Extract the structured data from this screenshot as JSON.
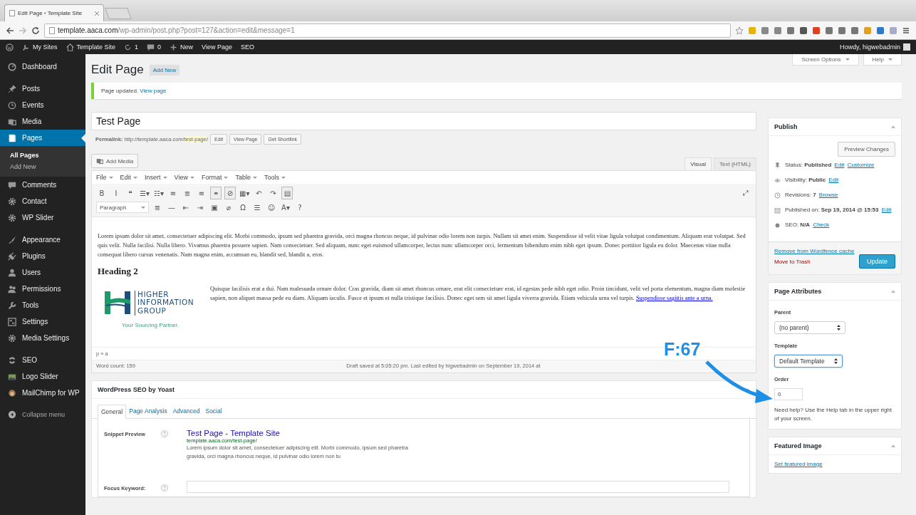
{
  "browser": {
    "tab_title": "Edit Page ‹ Template Site",
    "url_host": "template.aaca.com",
    "url_path": "/wp-admin/post.php?post=127&action=edit&message=1"
  },
  "admin_bar": {
    "items": [
      {
        "kind": "sites",
        "label": "My Sites"
      },
      {
        "kind": "home",
        "label": "Template Site"
      },
      {
        "kind": "updates",
        "label": "1"
      },
      {
        "kind": "comments",
        "label": "0"
      },
      {
        "kind": "new",
        "label": "New"
      },
      {
        "kind": "plain",
        "label": "View Page"
      },
      {
        "kind": "plain",
        "label": "SEO"
      }
    ],
    "greeting": "Howdy, higwebadmin"
  },
  "sidebar": {
    "groups": [
      {
        "items": [
          {
            "kind": "dashboard",
            "label": "Dashboard",
            "selected": false
          }
        ]
      },
      {
        "items": [
          {
            "kind": "pin",
            "label": "Posts",
            "selected": false
          },
          {
            "kind": "clock",
            "label": "Events",
            "selected": false
          },
          {
            "kind": "media",
            "label": "Media",
            "selected": false
          },
          {
            "kind": "page",
            "label": "Pages",
            "selected": true,
            "children": [
              {
                "label": "All Pages",
                "selected": true
              },
              {
                "label": "Add New",
                "selected": false
              }
            ]
          },
          {
            "kind": "comment",
            "label": "Comments",
            "selected": false
          },
          {
            "kind": "gear",
            "label": "Contact",
            "selected": false
          },
          {
            "kind": "gear",
            "label": "WP Slider",
            "selected": false
          }
        ]
      },
      {
        "items": [
          {
            "kind": "brush",
            "label": "Appearance",
            "selected": false
          },
          {
            "kind": "plug",
            "label": "Plugins",
            "selected": false
          },
          {
            "kind": "user",
            "label": "Users",
            "selected": false
          },
          {
            "kind": "users",
            "label": "Permissions",
            "selected": false
          },
          {
            "kind": "wrench",
            "label": "Tools",
            "selected": false
          },
          {
            "kind": "settings",
            "label": "Settings",
            "selected": false
          },
          {
            "kind": "gear",
            "label": "Media Settings",
            "selected": false
          }
        ]
      },
      {
        "items": [
          {
            "kind": "seo",
            "label": "SEO",
            "selected": false
          },
          {
            "kind": "image",
            "label": "Logo Slider",
            "selected": false
          },
          {
            "kind": "circle",
            "label": "MailChimp for WP",
            "selected": false
          }
        ]
      }
    ],
    "collapse": "Collapse menu"
  },
  "header": {
    "title": "Edit Page",
    "add_new": "Add New",
    "screen_options": "Screen Options",
    "help": "Help"
  },
  "notice": {
    "text": "Page updated.",
    "link": "View page"
  },
  "post": {
    "title": "Test Page",
    "permalink_label": "Permalink:",
    "permalink_base": "http://template.aaca.com/",
    "permalink_slug": "test-page",
    "permalink_end": "/",
    "buttons": [
      "Edit",
      "View Page",
      "Get Shortlink"
    ]
  },
  "editor": {
    "add_media": "Add Media",
    "tabs": [
      {
        "label": "Visual",
        "selected": true
      },
      {
        "label": "Text (HTML)",
        "selected": false
      }
    ],
    "menu": [
      "File",
      "Edit",
      "Insert",
      "View",
      "Format",
      "Table",
      "Tools"
    ],
    "toolbar_1": [
      {
        "glyph": "B",
        "active": false
      },
      {
        "glyph": "I",
        "active": false
      },
      {
        "glyph": "❝",
        "active": false
      },
      {
        "glyph": "☰▾",
        "active": false
      },
      {
        "glyph": "☷▾",
        "active": false
      },
      {
        "glyph": "≡",
        "active": false
      },
      {
        "glyph": "≣",
        "active": false
      },
      {
        "glyph": "≡",
        "active": false
      },
      {
        "glyph": "⚭",
        "active": true
      },
      {
        "glyph": "⊘",
        "active": true
      },
      {
        "glyph": "▦▾",
        "active": false
      },
      {
        "glyph": "↶",
        "active": false
      },
      {
        "glyph": "↷",
        "active": false
      },
      {
        "glyph": "▤",
        "active": true
      }
    ],
    "fullscreen": "⤢",
    "format": "Paragraph",
    "toolbar_2": [
      {
        "glyph": "≣",
        "active": false
      },
      {
        "glyph": "—",
        "active": false
      },
      {
        "glyph": "⇤",
        "active": false
      },
      {
        "glyph": "⇥",
        "active": false
      },
      {
        "glyph": "▣",
        "active": false
      },
      {
        "glyph": "⌀",
        "active": false
      },
      {
        "glyph": "Ω",
        "active": false
      },
      {
        "glyph": "☰",
        "active": false
      },
      {
        "glyph": "☺",
        "active": false
      },
      {
        "glyph": "A▾",
        "active": false
      },
      {
        "glyph": "?",
        "active": false
      }
    ],
    "paragraph_1": "Lorem ipsum dolor sit amet, consectetuer adipiscing elit. Morbi commodo, ipsum sed pharetra gravida, orci magna rhoncus neque, id pulvinar odio lorem non turpis. Nullam sit amet enim. Suspendisse id velit vitae ligula volutpat condimentum. Aliquam erat volutpat. Sed quis velit. Nulla facilisi. Nulla libero. Vivamus pharetra posuere sapien. Nam consectetuer. Sed aliquam, nunc eget euismod ullamcorper, lectus nunc ullamcorper orci, fermentum bibendum enim nibh eget ipsum. Donec porttitor ligula eu dolor. Maecenas vitae nulla consequat libero cursus venenatis. Nam magna enim, accumsan eu, blandit sed, blandit a, eros.",
    "heading": "Heading 2",
    "logo_lines": [
      "HIGHER",
      "INFORMATION",
      "GROUP"
    ],
    "logo_tagline": "Your Sourcing Partner.",
    "paragraph_2": "Quisque facilisis erat a dui. Nam malesuada ornare dolor. Cras gravida, diam sit amet rhoncus ornare, erat elit consectetuer erat, id egestas pede nibh eget odio. Proin tincidunt, velit vel porta elementum, magna diam molestie sapien, non aliquet massa pede eu diam. Aliquam iaculis. Fusce et ipsum et nulla tristique facilisis. Donec eget sem sit amet ligula viverra gravida. Etiam vehicula urna vel turpis. ",
    "paragraph_2_link": "Suspendisse sagittis ante a urna.",
    "path": "p » a",
    "word_count": "Word count: 159",
    "draft": "Draft saved at 5:05:20 pm. Last edited by higwebadmin on September 19, 2014 at"
  },
  "seo": {
    "title": "WordPress SEO by Yoast",
    "tabs": [
      {
        "label": "General",
        "selected": true
      },
      {
        "label": "Page Analysis",
        "selected": false
      },
      {
        "label": "Advanced",
        "selected": false
      },
      {
        "label": "Social",
        "selected": false
      }
    ],
    "snippet_label": "Snippet Preview",
    "snippet_title": "Test Page - Template Site",
    "snippet_url": "template.aaca.com/test-page/",
    "snippet_text": "Lorem ipsum dolor sit amet, consectetuer adipiscing elit. Morbi commodo, ipsum sed pharetra gravida, orci magna rhoncus neque, id pulvinar odio lorem non tu",
    "focus_label": "Focus Keyword:"
  },
  "publish": {
    "title": "Publish",
    "preview": "Preview Changes",
    "rows": [
      {
        "kind": "status",
        "label": "Status:",
        "value": "Published",
        "links": [
          "Edit",
          "Customize"
        ]
      },
      {
        "kind": "visibility",
        "label": "Visibility:",
        "value": "Public",
        "links": [
          "Edit"
        ]
      },
      {
        "kind": "revisions",
        "label": "Revisions:",
        "value": "7",
        "links": [
          "Browse"
        ]
      },
      {
        "kind": "date",
        "label": "Published on:",
        "value": "Sep 19, 2014 @ 15:53",
        "links": [
          "Edit"
        ]
      },
      {
        "kind": "seo",
        "label": "SEO:",
        "value": "N/A",
        "links": [
          "Check"
        ]
      }
    ],
    "cache_link": "Remove from Wordfence cache",
    "trash": "Move to Trash",
    "update": "Update"
  },
  "attributes": {
    "title": "Page Attributes",
    "parent_label": "Parent",
    "parent": "(no parent)",
    "template_label": "Template",
    "template": "Default Template",
    "order_label": "Order",
    "order": "0",
    "help": "Need help? Use the Help tab in the upper right of your screen."
  },
  "featured": {
    "title": "Featured Image",
    "link": "Set featured image"
  },
  "callout": {
    "label": "F:67"
  }
}
